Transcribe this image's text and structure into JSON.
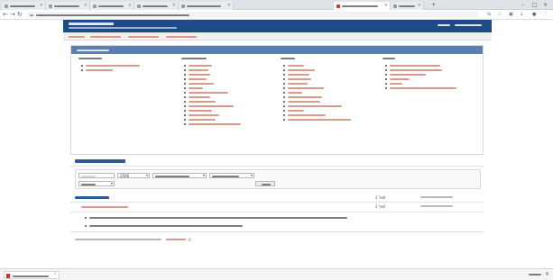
{
  "browser": {
    "tabs": [
      {
        "title": "—",
        "active": false
      },
      {
        "title": "—",
        "active": false
      },
      {
        "title": "—",
        "active": false
      },
      {
        "title": "—",
        "active": false
      },
      {
        "title": "—",
        "active": false
      },
      {
        "title": "—",
        "active": true
      },
      {
        "title": "—",
        "active": false
      }
    ],
    "url": "—"
  },
  "site": {
    "title": "—",
    "subtitle": "—",
    "nav": [
      "—",
      "—",
      "—",
      "—"
    ],
    "header_links": [
      "—",
      "—"
    ]
  },
  "panel": {
    "heading": "—",
    "columns": [
      {
        "heading": "—",
        "items": [
          "—",
          "—"
        ]
      },
      {
        "heading": "—",
        "items": [
          "—",
          "—",
          "—",
          "—",
          "—",
          "—",
          "—",
          "—",
          "—",
          "—",
          "—",
          "—",
          "—",
          "—"
        ]
      },
      {
        "heading": "—",
        "items": [
          "—",
          "—",
          "—",
          "—",
          "—",
          "—",
          "—",
          "—",
          "—",
          "—",
          "—",
          "—",
          "—"
        ]
      },
      {
        "heading": "—",
        "items": [
          "—",
          "—",
          "—",
          "—",
          "—",
          "—"
        ]
      }
    ]
  },
  "reports": {
    "title": "—",
    "filters": {
      "keyword": "—",
      "year": "2566",
      "category": "—",
      "department": "—",
      "unit": "—",
      "search_button": "—"
    },
    "group_title": "—",
    "group_count": "2 ไฟล์",
    "group_date": "—",
    "row": {
      "title": "—",
      "count": "2 ไฟล์",
      "date": "—"
    },
    "sub_items": [
      "—",
      "—"
    ],
    "footer_text": "—",
    "footer_link": "—",
    "footer_count": "0"
  },
  "download_bar": {
    "filename": "—",
    "show_all": "—"
  }
}
